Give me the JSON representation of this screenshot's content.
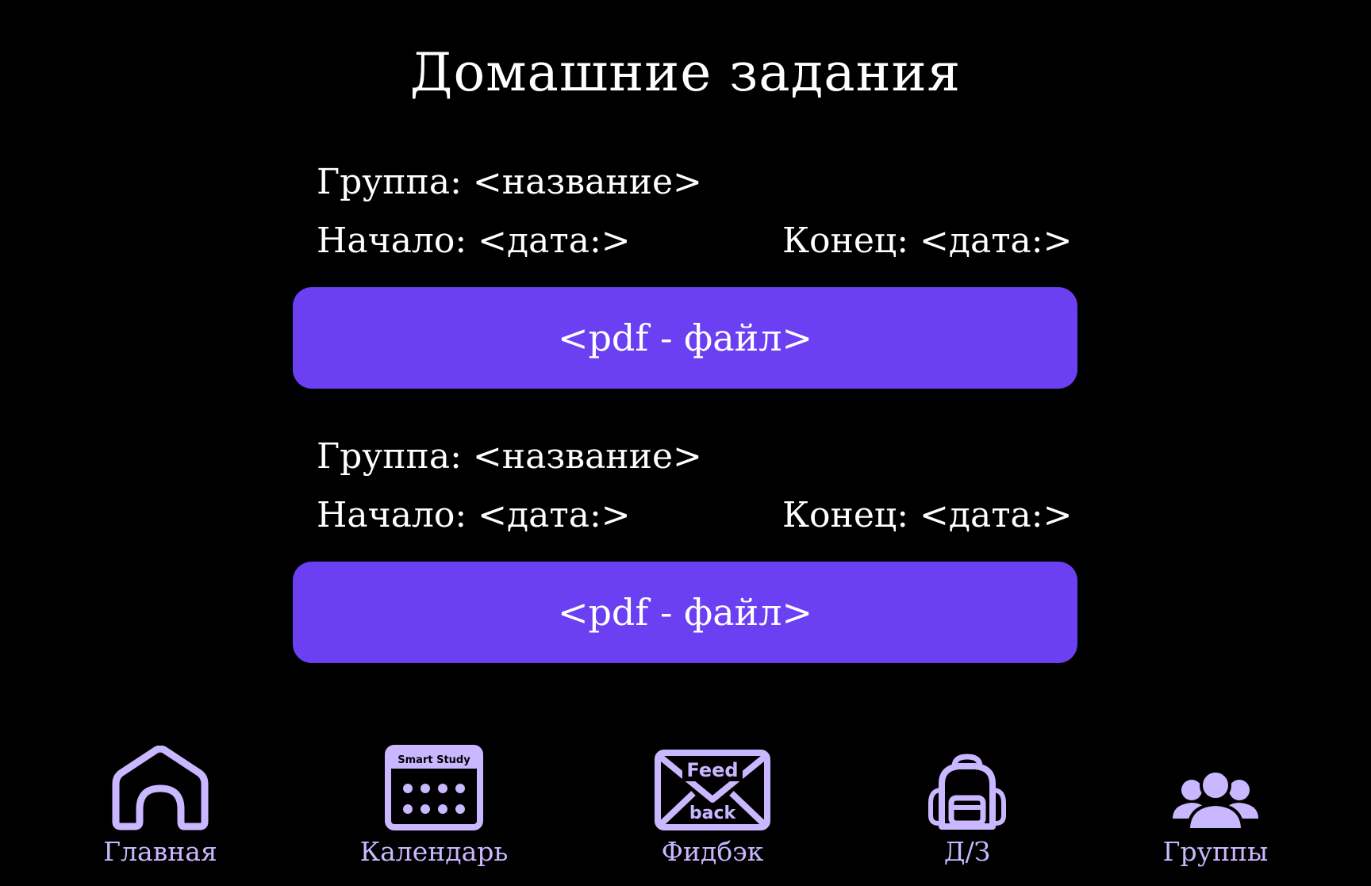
{
  "page": {
    "title": "Домашние задания"
  },
  "assignments": [
    {
      "group": "Группа: <название>",
      "start": "Начало: <дата:>",
      "end": "Конец: <дата:>",
      "file": "<pdf - файл>"
    },
    {
      "group": "Группа: <название>",
      "start": "Начало: <дата:>",
      "end": "Конец: <дата:>",
      "file": "<pdf - файл>"
    }
  ],
  "nav": {
    "home": {
      "label": "Главная",
      "icon": "home-icon"
    },
    "calendar": {
      "label": "Календарь",
      "icon": "calendar-icon",
      "icon_text": "Smart Study"
    },
    "feedback": {
      "label": "Фидбэк",
      "icon": "envelope-icon",
      "icon_text_top": "Feed",
      "icon_text_bottom": "back"
    },
    "homework": {
      "label": "Д/З",
      "icon": "backpack-icon"
    },
    "groups": {
      "label": "Группы",
      "icon": "users-icon"
    }
  },
  "colors": {
    "background": "#000000",
    "accent": "#6b3ff2",
    "nav": "#c9b8ff",
    "text": "#ffffff"
  }
}
